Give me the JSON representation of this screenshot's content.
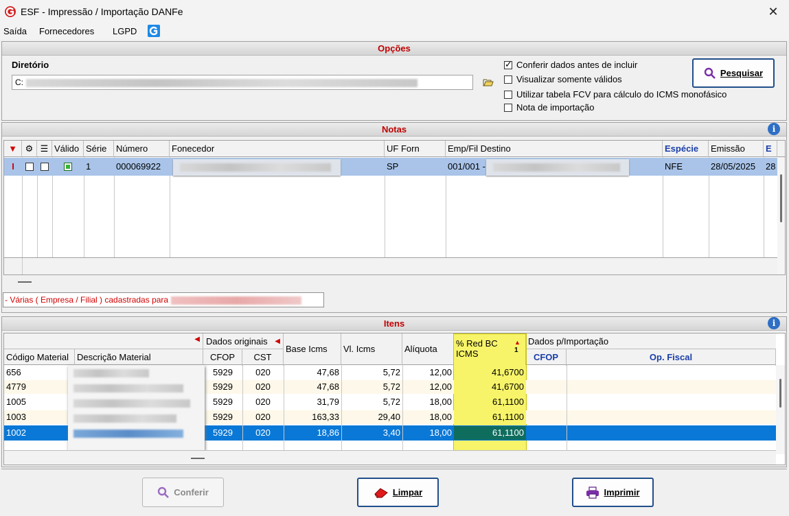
{
  "window": {
    "title": "ESF - Impressão / Importação DANFe",
    "close_glyph": "✕"
  },
  "menu": {
    "items": [
      "Saída",
      "Fornecedores",
      "LGPD"
    ]
  },
  "opcoes": {
    "header": "Opções",
    "dir_label": "Diretório",
    "dir_value_prefix": "C:",
    "checkboxes": [
      {
        "label": "Conferir dados antes de incluir",
        "checked": true
      },
      {
        "label": "Visualizar somente válidos",
        "checked": false
      },
      {
        "label": "Utilizar tabela FCV para cálculo do ICMS monofásico",
        "checked": false
      },
      {
        "label": "Nota de importação",
        "checked": false
      }
    ],
    "search_button": "Pesquisar"
  },
  "notas": {
    "header": "Notas",
    "info_glyph": "i",
    "columns": [
      "Válido",
      "Série",
      "Número",
      "Fonecedor",
      "UF Forn",
      "Emp/Fil Destino",
      "Espécie",
      "Emissão",
      "E"
    ],
    "rows": [
      {
        "marker": "I",
        "serie": "1",
        "numero": "000069922",
        "uf": "SP",
        "emp_fil": "001/001 -",
        "especie": "NFE",
        "emissao": "28/05/2025",
        "extra": "28"
      }
    ],
    "message": "- Várias ( Empresa / Filial ) cadastradas para"
  },
  "itens": {
    "header": "Itens",
    "info_glyph": "i",
    "group_dados_originais": "Dados originais",
    "group_dados_importacao": "Dados p/Importação",
    "columns": {
      "codigo": "Código Material",
      "descricao": "Descrição Material",
      "cfop": "CFOP",
      "cst": "CST",
      "base": "Base Icms",
      "vl": "Vl. Icms",
      "aliquota": "Alíquota",
      "red": "% Red BC ICMS",
      "red_sort": "1",
      "cfop_imp": "CFOP",
      "op_fiscal": "Op. Fiscal"
    },
    "rows": [
      {
        "codigo": "656",
        "cfop": "5929",
        "cst": "020",
        "base": "47,68",
        "vl": "5,72",
        "aliquota": "12,00",
        "red": "41,6700"
      },
      {
        "codigo": "4779",
        "cfop": "5929",
        "cst": "020",
        "base": "47,68",
        "vl": "5,72",
        "aliquota": "12,00",
        "red": "41,6700"
      },
      {
        "codigo": "1005",
        "cfop": "5929",
        "cst": "020",
        "base": "31,79",
        "vl": "5,72",
        "aliquota": "18,00",
        "red": "61,1100"
      },
      {
        "codigo": "1003",
        "cfop": "5929",
        "cst": "020",
        "base": "163,33",
        "vl": "29,40",
        "aliquota": "18,00",
        "red": "61,1100"
      },
      {
        "codigo": "1002",
        "cfop": "5929",
        "cst": "020",
        "base": "18,86",
        "vl": "3,40",
        "aliquota": "18,00",
        "red": "61,1100"
      }
    ],
    "selected_row": 4
  },
  "footer": {
    "conferir": "Conferir",
    "limpar": "Limpar",
    "imprimir": "Imprimir"
  },
  "colors": {
    "accent": "#1f4e8a",
    "selected_row": "#0a78d7",
    "highlight": "#f7f46a",
    "header_red": "#c00000"
  }
}
